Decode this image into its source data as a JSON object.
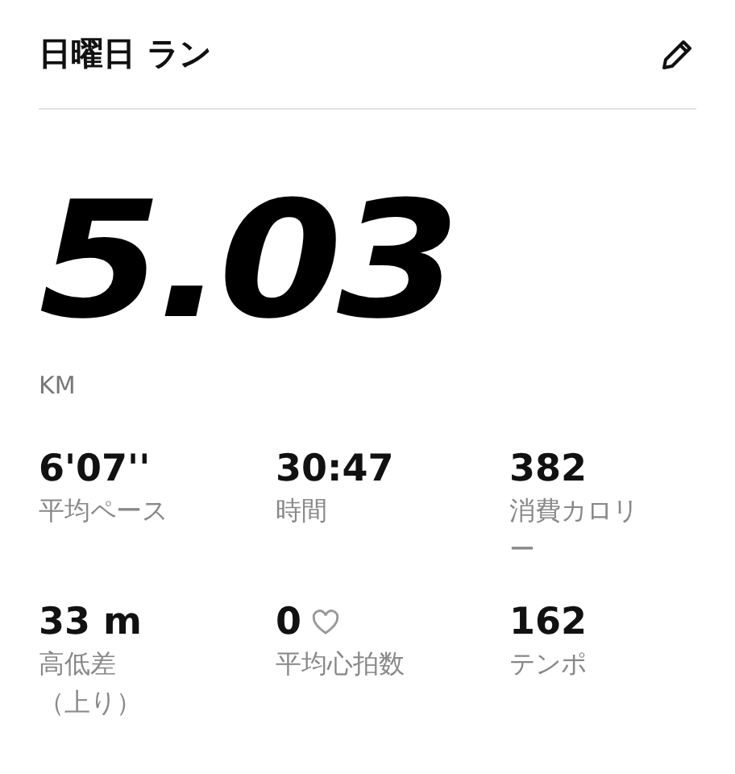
{
  "header": {
    "title": "日曜日 ラン"
  },
  "distance": {
    "value": "5.03",
    "unit": "KM"
  },
  "stats": [
    {
      "value": "6'07''",
      "label": [
        "平均ペース"
      ],
      "heart": false
    },
    {
      "value": "30:47",
      "label": [
        "時間"
      ],
      "heart": false
    },
    {
      "value": "382",
      "label": [
        "消費カロリ",
        "ー"
      ],
      "heart": false
    },
    {
      "value": "33 m",
      "label": [
        "高低差",
        "（上り）"
      ],
      "heart": false
    },
    {
      "value": "0",
      "label": [
        "平均心拍数"
      ],
      "heart": true
    },
    {
      "value": "162",
      "label": [
        "テンポ"
      ],
      "heart": false
    }
  ]
}
